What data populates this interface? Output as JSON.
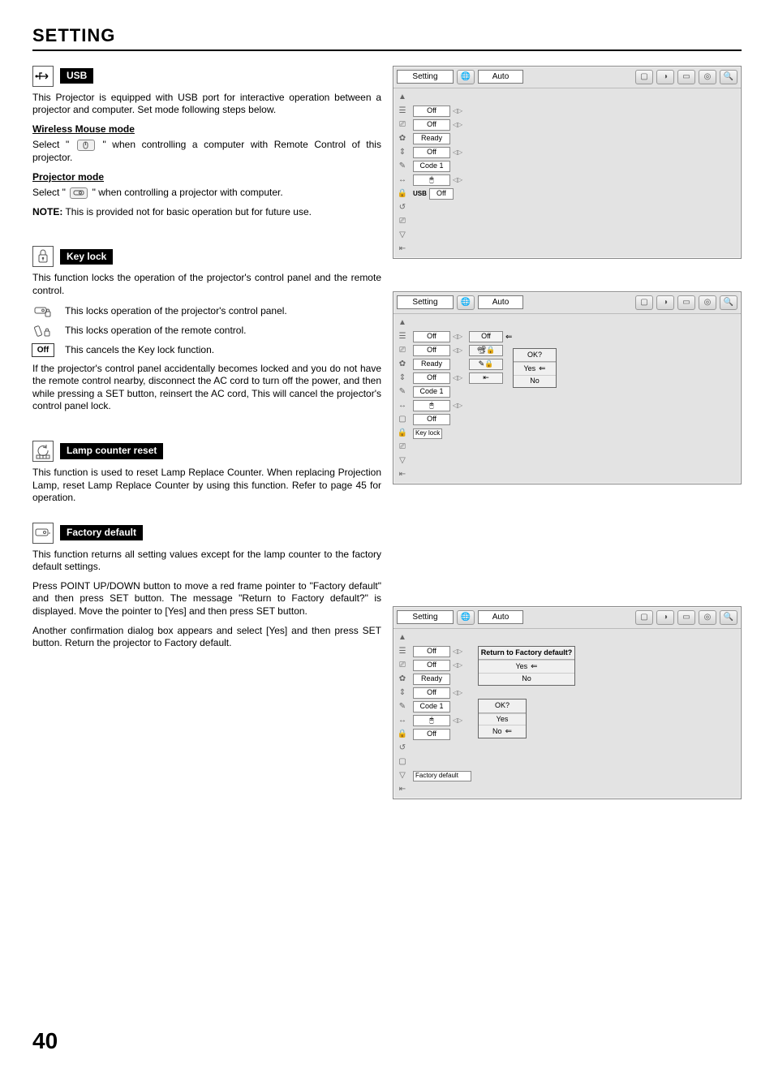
{
  "page": {
    "title": "SETTING",
    "number": "40"
  },
  "usb": {
    "label": "USB",
    "intro": "This Projector is equipped with USB port for interactive operation between a projector and computer. Set mode following steps below.",
    "wireless_head": "Wireless Mouse mode",
    "wireless_pre": "Select \"",
    "wireless_post": "\" when controlling a computer with Remote Control of this projector.",
    "projector_head": "Projector mode",
    "projector_pre": "Select \"",
    "projector_post": "\" when controlling a projector with computer.",
    "note_label": "NOTE:",
    "note_text": " This is provided not for basic operation but for future use."
  },
  "keylock": {
    "label": "Key lock",
    "intro": "This function locks the operation of the projector's control panel and the remote control.",
    "panel_lock": "This locks operation of the projector's control panel.",
    "remote_lock": "This locks operation of the remote control.",
    "off_label": "Off",
    "cancel_text": "This cancels the Key lock function.",
    "recover": "If the projector's control panel accidentally becomes locked and you do not have the remote control nearby, disconnect the AC cord to turn off the power, and then while pressing a SET button, reinsert the AC cord, This will cancel the projector's control panel lock."
  },
  "lamp": {
    "label": "Lamp counter reset",
    "text": "This function is used to reset Lamp Replace Counter.  When replacing Projection Lamp, reset Lamp Replace Counter by using this function.  Refer to page 45 for operation."
  },
  "factory": {
    "label": "Factory default",
    "intro": "This function returns all setting values except for the lamp counter to the factory default settings.",
    "steps": "Press POINT UP/DOWN button to move a red frame pointer to \"Factory default\" and then press SET button.  The message \"Return to Factory default?\" is displayed.  Move the pointer to [Yes] and then press SET button.",
    "steps2": "Another confirmation dialog box appears and select [Yes] and then press SET button. Return the projector to Factory default."
  },
  "osd": {
    "setting": "Setting",
    "auto": "Auto",
    "rows": {
      "r1": "Off",
      "r2": "Off",
      "r3": "Ready",
      "r4": "Off",
      "r5": "Code 1",
      "r7": "Off"
    },
    "usb_tag": "USB",
    "keylock_tag": "Key lock",
    "popup_off": "Off",
    "ok": "OK?",
    "yes": "Yes",
    "no": "No",
    "factory_q": "Return to Factory default?",
    "factory_tag": "Factory default"
  }
}
